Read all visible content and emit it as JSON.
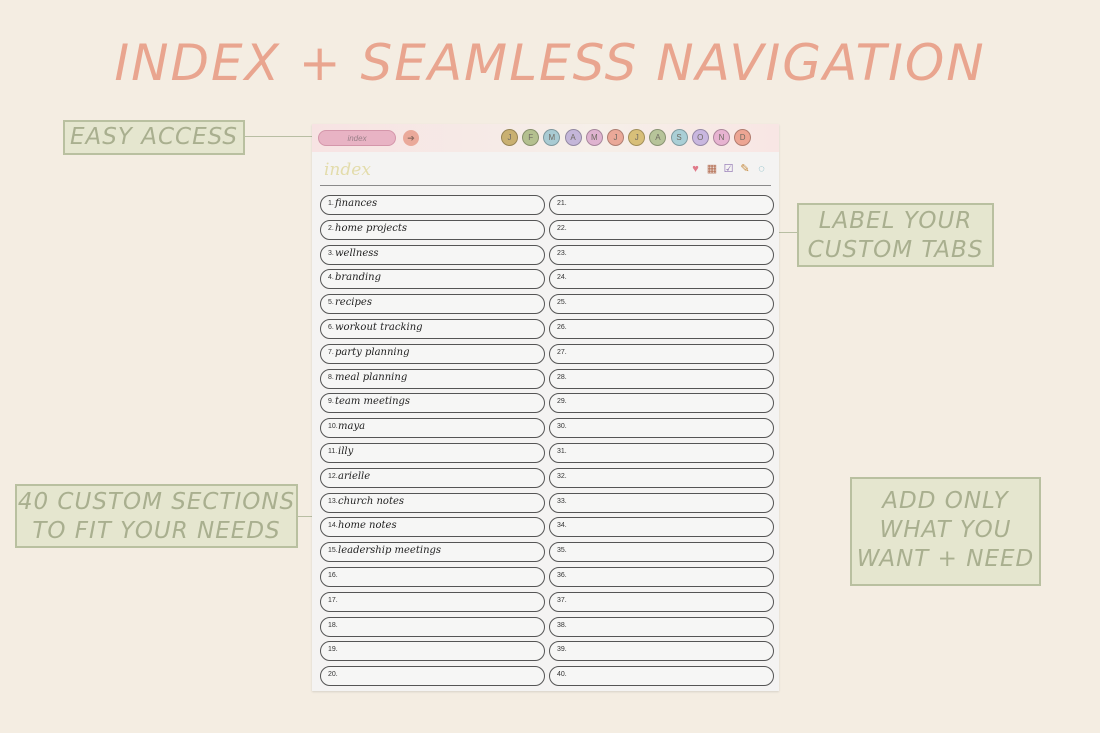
{
  "headline": "INDEX + SEAMLESS NAVIGATION",
  "callouts": {
    "easy_access": [
      "EASY ACCESS"
    ],
    "label_tabs": [
      "LABEL YOUR",
      "CUSTOM TABS"
    ],
    "custom_sections": [
      "40 CUSTOM SECTIONS",
      "TO FIT YOUR NEEDS"
    ],
    "add_only": [
      "ADD ONLY",
      "WHAT YOU",
      "WANT + NEED"
    ]
  },
  "planner": {
    "index_tab_label": "index",
    "back_icon": "back-arrow-icon",
    "page_title": "index",
    "month_tabs": [
      {
        "letter": "J",
        "color": "#c9b071"
      },
      {
        "letter": "F",
        "color": "#b4c08f"
      },
      {
        "letter": "M",
        "color": "#a9cbd3"
      },
      {
        "letter": "A",
        "color": "#c4b6d9"
      },
      {
        "letter": "M",
        "color": "#dfb3d0"
      },
      {
        "letter": "J",
        "color": "#eaa898"
      },
      {
        "letter": "J",
        "color": "#d8bf79"
      },
      {
        "letter": "A",
        "color": "#b7c49a"
      },
      {
        "letter": "S",
        "color": "#aacfd6"
      },
      {
        "letter": "O",
        "color": "#c9b7df"
      },
      {
        "letter": "N",
        "color": "#e7b3d1"
      },
      {
        "letter": "D",
        "color": "#eda593"
      }
    ],
    "tools": [
      {
        "name": "heart-icon",
        "glyph": "♥",
        "color": "#e07a8a"
      },
      {
        "name": "calendar-icon",
        "glyph": "▦",
        "color": "#b26b4f"
      },
      {
        "name": "checklist-icon",
        "glyph": "☑",
        "color": "#8c6fb0"
      },
      {
        "name": "pencil-icon",
        "glyph": "✎",
        "color": "#c58a3e"
      },
      {
        "name": "chat-bubble-icon",
        "glyph": "◌",
        "color": "#5fa7b5"
      }
    ],
    "entries": [
      {
        "num": "1.",
        "label": "finances"
      },
      {
        "num": "2.",
        "label": "home projects"
      },
      {
        "num": "3.",
        "label": "wellness"
      },
      {
        "num": "4.",
        "label": "branding"
      },
      {
        "num": "5.",
        "label": "recipes"
      },
      {
        "num": "6.",
        "label": "workout tracking"
      },
      {
        "num": "7.",
        "label": "party planning"
      },
      {
        "num": "8.",
        "label": "meal planning"
      },
      {
        "num": "9.",
        "label": "team meetings"
      },
      {
        "num": "10.",
        "label": "maya"
      },
      {
        "num": "11.",
        "label": "illy"
      },
      {
        "num": "12.",
        "label": "arielle"
      },
      {
        "num": "13.",
        "label": "church notes"
      },
      {
        "num": "14.",
        "label": "home notes"
      },
      {
        "num": "15.",
        "label": "leadership meetings"
      },
      {
        "num": "16.",
        "label": ""
      },
      {
        "num": "17.",
        "label": ""
      },
      {
        "num": "18.",
        "label": ""
      },
      {
        "num": "19.",
        "label": ""
      },
      {
        "num": "20.",
        "label": ""
      },
      {
        "num": "21.",
        "label": ""
      },
      {
        "num": "22.",
        "label": ""
      },
      {
        "num": "23.",
        "label": ""
      },
      {
        "num": "24.",
        "label": ""
      },
      {
        "num": "25.",
        "label": ""
      },
      {
        "num": "26.",
        "label": ""
      },
      {
        "num": "27.",
        "label": ""
      },
      {
        "num": "28.",
        "label": ""
      },
      {
        "num": "29.",
        "label": ""
      },
      {
        "num": "30.",
        "label": ""
      },
      {
        "num": "31.",
        "label": ""
      },
      {
        "num": "32.",
        "label": ""
      },
      {
        "num": "33.",
        "label": ""
      },
      {
        "num": "34.",
        "label": ""
      },
      {
        "num": "35.",
        "label": ""
      },
      {
        "num": "36.",
        "label": ""
      },
      {
        "num": "37.",
        "label": ""
      },
      {
        "num": "38.",
        "label": ""
      },
      {
        "num": "39.",
        "label": ""
      },
      {
        "num": "40.",
        "label": ""
      }
    ]
  }
}
